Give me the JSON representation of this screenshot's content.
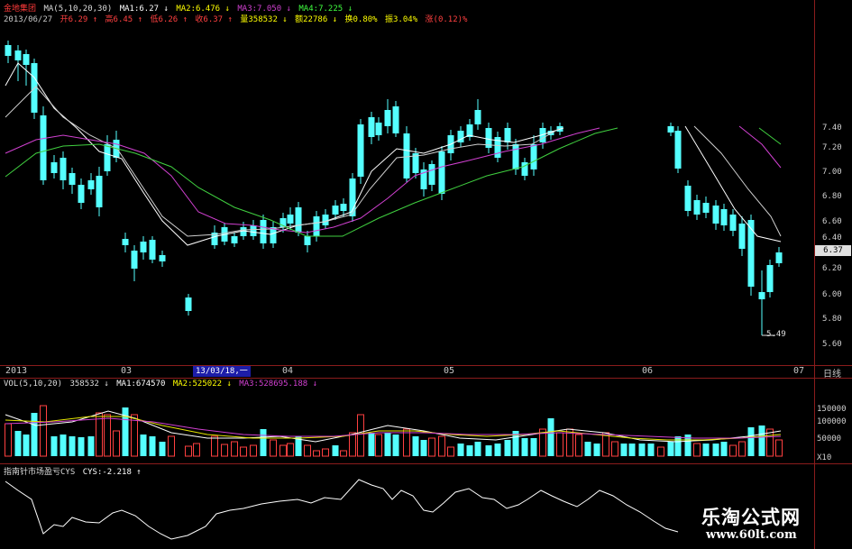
{
  "header": {
    "title": "金地集团",
    "ma_label": "MA(5,10,20,30)",
    "ma1": "MA1:6.27 ↓",
    "ma2": "MA2:6.476 ↓",
    "ma3": "MA3:7.050 ↓",
    "ma4": "MA4:7.225 ↓",
    "date": "2013/06/27",
    "open": "开6.29 ↑",
    "high": "高6.45 ↑",
    "low": "低6.26 ↑",
    "close": "收6.37 ↑",
    "volume": "量358532 ↓",
    "amount": "额22786 ↓",
    "turnover": "换0.80%",
    "amplitude": "振3.04%",
    "change": "涨(0.12)%"
  },
  "price_axis": [
    "7.40",
    "7.20",
    "7.00",
    "6.80",
    "6.60",
    "6.40",
    "6.20",
    "6.00",
    "5.80",
    "5.60"
  ],
  "current_price": "6.37",
  "low_marker": "5.49",
  "date_axis": [
    "2013",
    "03",
    "04",
    "05",
    "06",
    "07"
  ],
  "cursor_date": "13/03/18,一",
  "period_label": "日线",
  "volume_header": {
    "label": "VOL(5,10,20)",
    "value": "358532 ↓",
    "ma1": "MA1:674570",
    "ma2": "MA2:525022 ↓",
    "ma3": "MA3:528695.188 ↓"
  },
  "volume_axis": [
    "150000",
    "100000",
    "50000",
    "X10"
  ],
  "indicator_header": {
    "label": "指南针市场盈亏CYS",
    "value": "CYS:-2.218 ↑"
  },
  "watermark": {
    "cn": "乐淘公式网",
    "url": "www.60lt.com"
  },
  "colors": {
    "up": "#ff4040",
    "down": "#54ffff",
    "ma1": "#ffffff",
    "ma2": "#e6e600",
    "ma3": "#d040d0",
    "ma4": "#40d040",
    "grid": "#8a1c1c"
  }
}
